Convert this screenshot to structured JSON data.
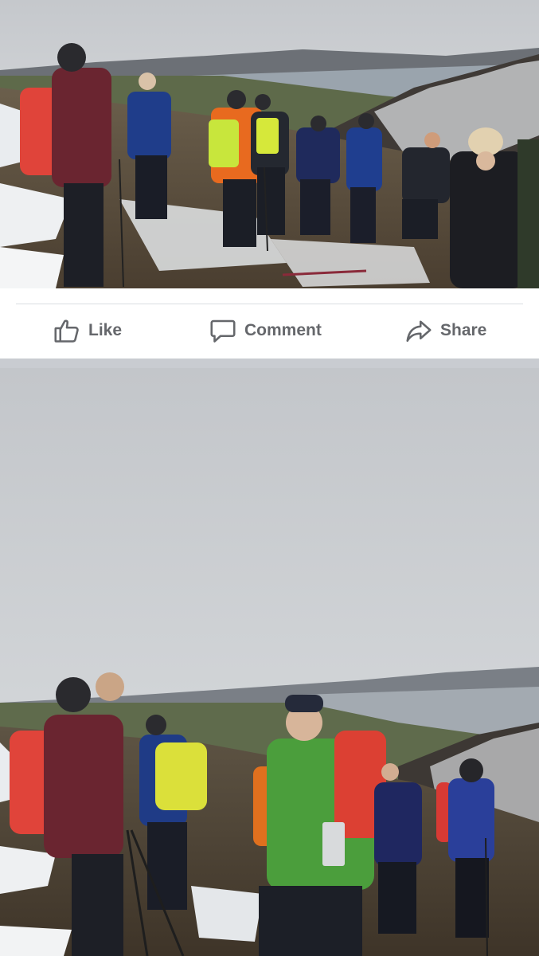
{
  "actions": {
    "like_label": "Like",
    "comment_label": "Comment",
    "share_label": "Share"
  },
  "photos": [
    {
      "subject": "group-of-hikers-on-snowy-mountain-with-sea-view"
    },
    {
      "subject": "hikers-on-snowy-slope-under-overcast-sky"
    }
  ],
  "colors": {
    "action_text": "#65676b",
    "card_background": "#ffffff",
    "feed_background": "#c9ccd1",
    "divider": "#dadde1"
  }
}
